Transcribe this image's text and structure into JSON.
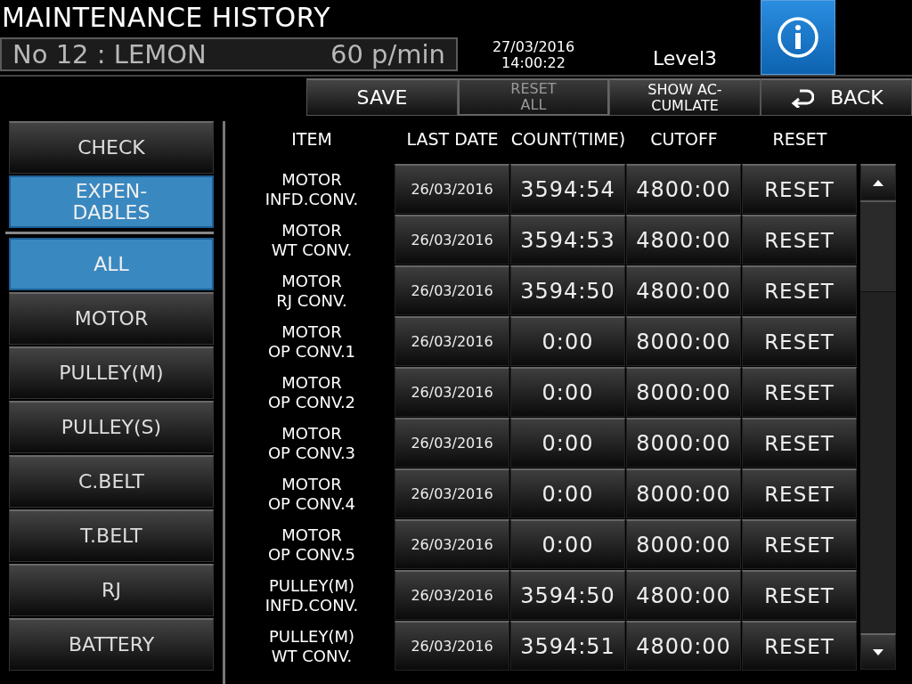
{
  "title": "MAINTENANCE HISTORY",
  "product": {
    "name": "No 12 : LEMON",
    "speed": "60 p/min"
  },
  "datetime": {
    "date": "27/03/2016",
    "time": "14:00:22"
  },
  "level": "Level3",
  "toolbar": [
    {
      "label": "SAVE",
      "disabled": false,
      "kind": "text"
    },
    {
      "label": "RESET\nALL",
      "disabled": true,
      "kind": "text"
    },
    {
      "label": "SHOW AC-\nCUMLATE",
      "disabled": false,
      "kind": "text"
    },
    {
      "label": "BACK",
      "disabled": false,
      "kind": "back"
    }
  ],
  "categories": [
    {
      "label": "CHECK",
      "selected": false
    },
    {
      "label": "EXPEN-\nDABLES",
      "selected": true
    }
  ],
  "filters": [
    {
      "label": "ALL",
      "selected": true
    },
    {
      "label": "MOTOR",
      "selected": false
    },
    {
      "label": "PULLEY(M)",
      "selected": false
    },
    {
      "label": "PULLEY(S)",
      "selected": false
    },
    {
      "label": "C.BELT",
      "selected": false
    },
    {
      "label": "T.BELT",
      "selected": false
    },
    {
      "label": "RJ",
      "selected": false
    },
    {
      "label": "BATTERY",
      "selected": false
    }
  ],
  "table": {
    "columns": [
      "ITEM",
      "LAST DATE",
      "COUNT(TIME)",
      "CUTOFF",
      "RESET"
    ],
    "rows": [
      {
        "item": "MOTOR\nINFD.CONV.",
        "last_date": "26/03/2016",
        "count": "3594:54",
        "cutoff": "4800:00",
        "reset": "RESET"
      },
      {
        "item": "MOTOR\nWT CONV.",
        "last_date": "26/03/2016",
        "count": "3594:53",
        "cutoff": "4800:00",
        "reset": "RESET"
      },
      {
        "item": "MOTOR\nRJ CONV.",
        "last_date": "26/03/2016",
        "count": "3594:50",
        "cutoff": "4800:00",
        "reset": "RESET"
      },
      {
        "item": "MOTOR\nOP CONV.1",
        "last_date": "26/03/2016",
        "count": "0:00",
        "cutoff": "8000:00",
        "reset": "RESET"
      },
      {
        "item": "MOTOR\nOP CONV.2",
        "last_date": "26/03/2016",
        "count": "0:00",
        "cutoff": "8000:00",
        "reset": "RESET"
      },
      {
        "item": "MOTOR\nOP CONV.3",
        "last_date": "26/03/2016",
        "count": "0:00",
        "cutoff": "8000:00",
        "reset": "RESET"
      },
      {
        "item": "MOTOR\nOP CONV.4",
        "last_date": "26/03/2016",
        "count": "0:00",
        "cutoff": "8000:00",
        "reset": "RESET"
      },
      {
        "item": "MOTOR\nOP CONV.5",
        "last_date": "26/03/2016",
        "count": "0:00",
        "cutoff": "8000:00",
        "reset": "RESET"
      },
      {
        "item": "PULLEY(M)\nINFD.CONV.",
        "last_date": "26/03/2016",
        "count": "3594:50",
        "cutoff": "4800:00",
        "reset": "RESET"
      },
      {
        "item": "PULLEY(M)\nWT CONV.",
        "last_date": "26/03/2016",
        "count": "3594:51",
        "cutoff": "4800:00",
        "reset": "RESET"
      }
    ]
  }
}
